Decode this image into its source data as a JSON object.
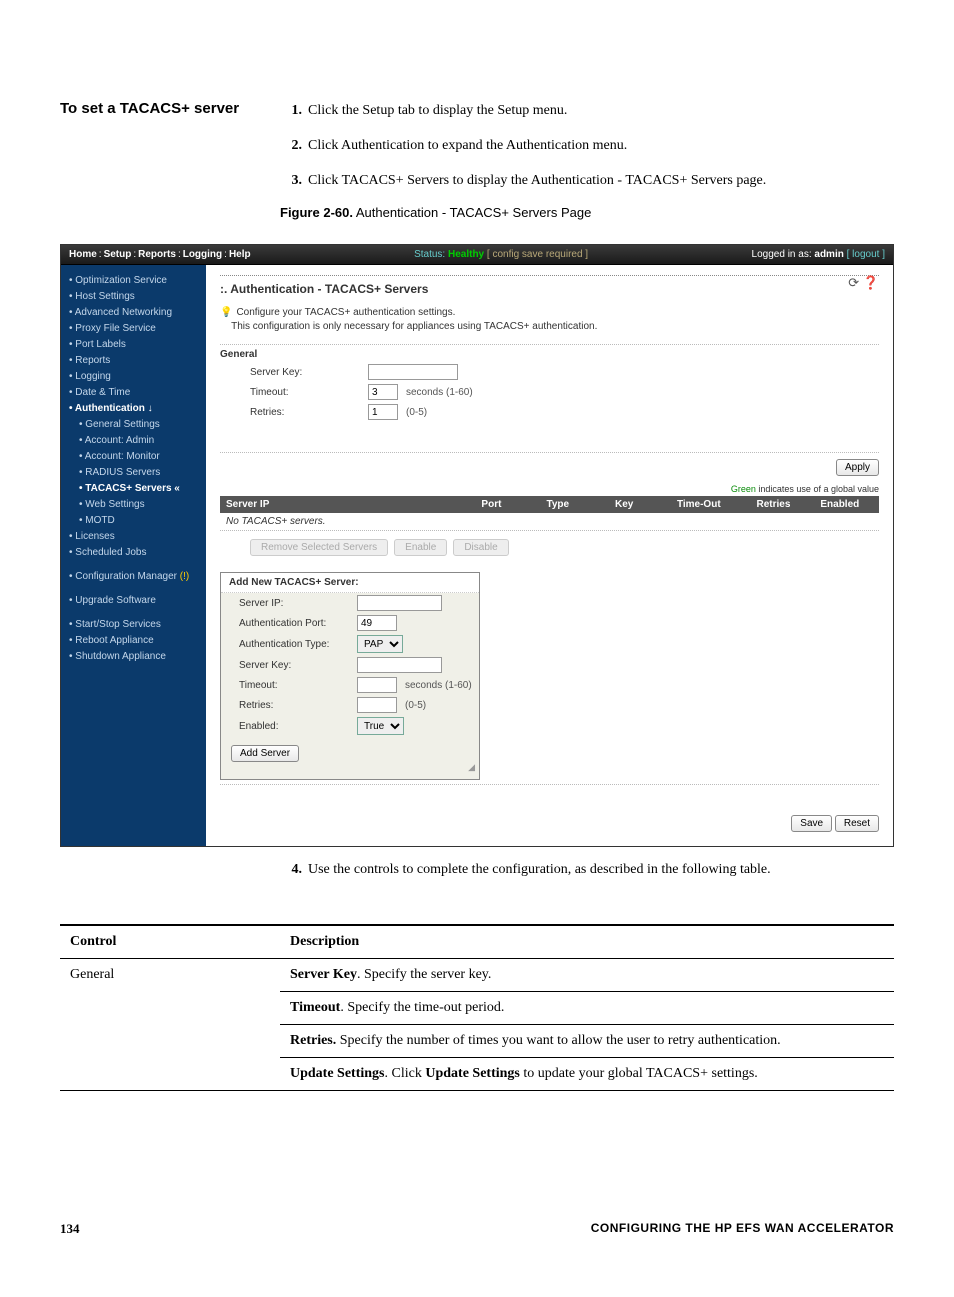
{
  "left_heading": "To set a TACACS+ server",
  "steps": [
    {
      "n": "1.",
      "text": "Click the Setup tab to display the Setup menu."
    },
    {
      "n": "2.",
      "text": "Click Authentication to expand the Authentication menu."
    },
    {
      "n": "3.",
      "text": "Click TACACS+ Servers to display the Authentication - TACACS+ Servers page."
    }
  ],
  "figure_caption_bold": "Figure 2-60.",
  "figure_caption_text": " Authentication - TACACS+ Servers Page",
  "ui": {
    "topbar": {
      "nav": [
        "Home",
        "Setup",
        "Reports",
        "Logging",
        "Help"
      ],
      "status_label": "Status:",
      "status_value": "Healthy",
      "config_required": "[ config save required ]",
      "logged_in": "Logged in as:",
      "user": "admin",
      "logout": "[ logout ]"
    },
    "sidebar": [
      {
        "label": "Optimization Service"
      },
      {
        "label": "Host Settings"
      },
      {
        "label": "Advanced Networking"
      },
      {
        "label": "Proxy File Service"
      },
      {
        "label": "Port Labels"
      },
      {
        "label": "Reports"
      },
      {
        "label": "Logging"
      },
      {
        "label": "Date & Time"
      },
      {
        "label": "Authentication ↓",
        "section": true
      },
      {
        "label": "General Settings",
        "indent": true
      },
      {
        "label": "Account: Admin",
        "indent": true
      },
      {
        "label": "Account: Monitor",
        "indent": true
      },
      {
        "label": "RADIUS Servers",
        "indent": true
      },
      {
        "label": "TACACS+ Servers «",
        "indent": true,
        "selected": true
      },
      {
        "label": "Web Settings",
        "indent": true
      },
      {
        "label": "MOTD",
        "indent": true
      },
      {
        "label": "Licenses"
      },
      {
        "label": "Scheduled Jobs"
      },
      {
        "label": "",
        "space": true
      },
      {
        "label": "Configuration Manager",
        "badge": "(!)"
      },
      {
        "label": "",
        "space": true
      },
      {
        "label": "Upgrade Software"
      },
      {
        "label": "",
        "space": true
      },
      {
        "label": "Start/Stop Services"
      },
      {
        "label": "Reboot Appliance"
      },
      {
        "label": "Shutdown Appliance"
      }
    ],
    "page_title": ":. Authentication - TACACS+ Servers",
    "hint1": "Configure your TACACS+ authentication settings.",
    "hint2": "This configuration is only necessary for appliances using TACACS+ authentication.",
    "general": {
      "label": "General",
      "server_key_label": "Server Key:",
      "timeout_label": "Timeout:",
      "timeout_value": "3",
      "timeout_hint": "seconds (1-60)",
      "retries_label": "Retries:",
      "retries_value": "1",
      "retries_hint": "(0-5)"
    },
    "apply": "Apply",
    "global_note_green": "Green",
    "global_note_rest": " indicates use of a global value",
    "table_headers": {
      "serverip": "Server IP",
      "port": "Port",
      "type": "Type",
      "key": "Key",
      "timeout": "Time-Out",
      "retries": "Retries",
      "enabled": "Enabled"
    },
    "no_servers": "No TACACS+ servers.",
    "actions": {
      "remove": "Remove Selected Servers",
      "enable": "Enable",
      "disable": "Disable"
    },
    "add": {
      "title": "Add New TACACS+ Server:",
      "server_ip_label": "Server IP:",
      "auth_port_label": "Authentication Port:",
      "auth_port_value": "49",
      "auth_type_label": "Authentication Type:",
      "auth_type_value": "PAP",
      "server_key_label": "Server Key:",
      "timeout_label": "Timeout:",
      "timeout_hint": "seconds (1-60)",
      "retries_label": "Retries:",
      "retries_hint": "(0-5)",
      "enabled_label": "Enabled:",
      "enabled_value": "True",
      "add_button": "Add Server"
    },
    "save": "Save",
    "reset": "Reset"
  },
  "step4": {
    "n": "4.",
    "text": "Use the controls to complete the configuration, as described in the following table."
  },
  "table": {
    "header_control": "Control",
    "header_description": "Description",
    "rows": [
      {
        "control": "General",
        "desc_bold": "Server Key",
        "desc_rest": ". Specify the server key."
      },
      {
        "control": "",
        "desc_bold": "Timeout",
        "desc_rest": ". Specify the time-out period."
      },
      {
        "control": "",
        "desc_bold": "Retries.",
        "desc_rest": " Specify the number of times you want to allow the user to retry authentication."
      },
      {
        "control": "",
        "desc_bold": "Update Settings",
        "desc_rest": ". Click ",
        "desc_bold2": "Update Settings",
        "desc_rest2": " to update your global TACACS+ settings."
      }
    ]
  },
  "page_number": "134",
  "footer_title": "CONFIGURING THE HP EFS WAN ACCELERATOR"
}
